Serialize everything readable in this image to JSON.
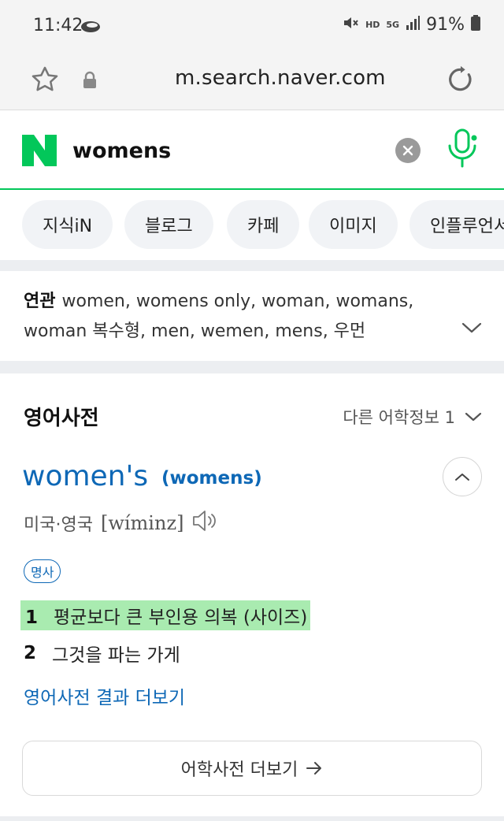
{
  "status_bar": {
    "time": "11:42",
    "hd_label": "HD",
    "network_label": "5G",
    "battery": "91%"
  },
  "browser": {
    "url": "m.search.naver.com"
  },
  "search": {
    "logo_letter": "N",
    "query": "womens"
  },
  "tabs": [
    "지식iN",
    "블로그",
    "카페",
    "이미지",
    "인플루언서"
  ],
  "related": {
    "label": "연관",
    "terms": "women, womens only, woman, womans, woman 복수형, men, wemen, mens, 우먼"
  },
  "dictionary": {
    "title": "영어사전",
    "other_info": "다른 어학정보 1",
    "headword": "women's",
    "headword_alt": "(womens)",
    "pronunciation_region": "미국·영국",
    "pronunciation_ipa": "[wíminz]",
    "pos": "명사",
    "meanings": [
      {
        "num": "1",
        "text": "평균보다 큰 부인용 의복 (사이즈)"
      },
      {
        "num": "2",
        "text": "그것을 파는 가게"
      }
    ],
    "more_results_link": "영어사전 결과 더보기",
    "more_vocab_button": "어학사전 더보기"
  },
  "colors": {
    "naver_green": "#03c75a",
    "link_blue": "#0e68b6",
    "highlight": "#8ce496"
  }
}
